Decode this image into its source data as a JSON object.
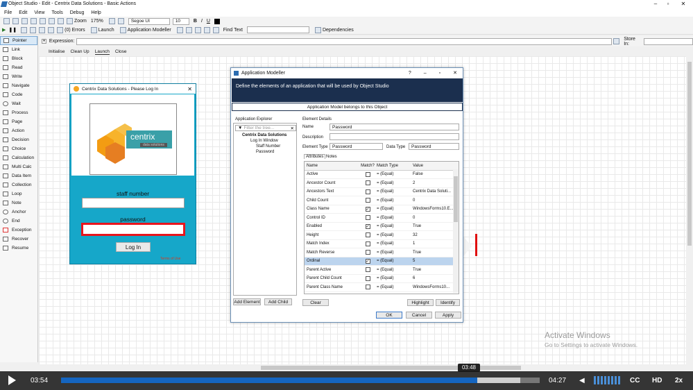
{
  "window": {
    "title": "Object Studio - Edit - Centrix Data Solutions - Basic Actions"
  },
  "menu": [
    "File",
    "Edit",
    "View",
    "Tools",
    "Debug",
    "Help"
  ],
  "toolbar": {
    "zoom_label": "Zoom",
    "zoom_value": "175%",
    "font_name": "Segoe UI",
    "font_size": "10"
  },
  "toolbar2": {
    "errors": "(0) Errors",
    "launch": "Launch",
    "app_modeller": "Application Modeller",
    "find_text": "Find Text",
    "dependencies": "Dependencies"
  },
  "expression": {
    "label": "Expression:",
    "store_in_label": "Store In:"
  },
  "palette": [
    "Pointer",
    "Link",
    "Block",
    "Read",
    "Write",
    "Navigate",
    "Code",
    "Wait",
    "Process",
    "Page",
    "Action",
    "Decision",
    "Choice",
    "Calculation",
    "Multi Calc",
    "Data Item",
    "Collection",
    "Loop",
    "Note",
    "Anchor",
    "End",
    "Exception",
    "Recover",
    "Resume"
  ],
  "page_tabs": [
    "Initialise",
    "Clean Up",
    "Launch",
    "Close"
  ],
  "login": {
    "title": "Centrix Data Solutions - Please Log In",
    "brand": "centrix",
    "brand_sub": "data solutions",
    "staff_label": "staff number",
    "password_label": "password",
    "login_button": "Log In",
    "terms": "Terms of Use"
  },
  "modeller": {
    "title": "Application Modeller",
    "header": "Define the elements of an application that will be used by Object Studio",
    "belongs": "Application Model belongs to this Object",
    "explorer_label": "Application Explorer",
    "filter_placeholder": "Filter the tree...",
    "tree": [
      "Centrix Data Solutions",
      "Log In Window",
      "Staff Number",
      "Password"
    ],
    "details_label": "Element Details",
    "name_label": "Name",
    "name_value": "Password",
    "description_label": "Description",
    "element_type_label": "Element Type",
    "element_type_value": "Password",
    "data_type_label": "Data Type",
    "data_type_value": "Password",
    "tab_attributes": "Attributes",
    "tab_notes": "Notes",
    "columns": [
      "Name",
      "Match?",
      "Match Type",
      "Value"
    ],
    "rows": [
      {
        "name": "Active",
        "match": false,
        "type": "= (Equal)",
        "value": "False"
      },
      {
        "name": "Ancestor Count",
        "match": false,
        "type": "= (Equal)",
        "value": "2"
      },
      {
        "name": "Ancestors Text",
        "match": false,
        "type": "= (Equal)",
        "value": "Centrix Data Soluti..."
      },
      {
        "name": "Child Count",
        "match": false,
        "type": "= (Equal)",
        "value": "0"
      },
      {
        "name": "Class Name",
        "match": true,
        "type": "= (Equal)",
        "value": "WindowsForms10.E..."
      },
      {
        "name": "Control ID",
        "match": false,
        "type": "= (Equal)",
        "value": "0"
      },
      {
        "name": "Enabled",
        "match": true,
        "type": "= (Equal)",
        "value": "True"
      },
      {
        "name": "Height",
        "match": false,
        "type": "= (Equal)",
        "value": "32"
      },
      {
        "name": "Match Index",
        "match": false,
        "type": "= (Equal)",
        "value": "1"
      },
      {
        "name": "Match Reverse",
        "match": false,
        "type": "= (Equal)",
        "value": "True"
      },
      {
        "name": "Ordinal",
        "match": true,
        "type": "= (Equal)",
        "value": "5"
      },
      {
        "name": "Parent Active",
        "match": false,
        "type": "= (Equal)",
        "value": "True"
      },
      {
        "name": "Parent Child Count",
        "match": false,
        "type": "= (Equal)",
        "value": "6"
      },
      {
        "name": "Parent Class Name",
        "match": false,
        "type": "= (Equal)",
        "value": "WindowsForms10..."
      }
    ],
    "add_element": "Add Element",
    "add_child": "Add Child",
    "clear": "Clear",
    "highlight": "Highlight",
    "identify": "Identify",
    "ok": "OK",
    "cancel": "Cancel",
    "apply": "Apply"
  },
  "watermark": {
    "line1": "Activate Windows",
    "line2": "Go to Settings to activate Windows."
  },
  "video": {
    "current": "03:54",
    "duration": "04:27",
    "hover_time": "03:48",
    "progress": 0.87,
    "buffered": 0.96,
    "cc": "CC",
    "hd": "HD",
    "speed": "2x"
  }
}
